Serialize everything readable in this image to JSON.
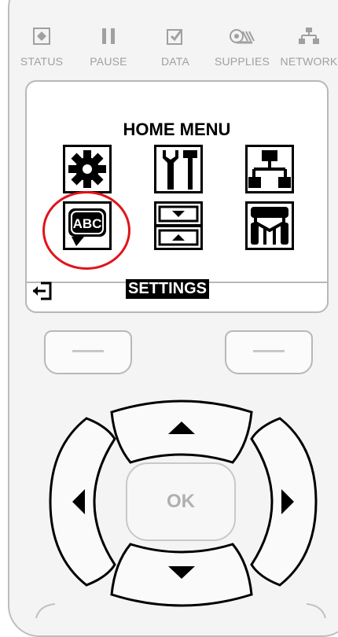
{
  "status_bar": {
    "items": [
      {
        "label": "STATUS",
        "icon": "status-diamond-icon"
      },
      {
        "label": "PAUSE",
        "icon": "pause-icon"
      },
      {
        "label": "DATA",
        "icon": "data-icon"
      },
      {
        "label": "SUPPLIES",
        "icon": "supplies-icon"
      },
      {
        "label": "NETWORK",
        "icon": "network-icon"
      }
    ],
    "color": "#a0a0a0"
  },
  "screen": {
    "title": "HOME MENU",
    "selected_label": "SETTINGS",
    "menu_icons": [
      "settings-gear-icon",
      "tools-icon",
      "network-tree-icon",
      "language-abc-icon",
      "sensor-icon",
      "ports-icon"
    ],
    "highlighted_icon": "language-abc-icon",
    "highlight_color": "#e1141b"
  },
  "keypad": {
    "ok_label": "OK",
    "buttons": [
      "left-softkey",
      "right-softkey",
      "up-arrow",
      "left-arrow",
      "ok",
      "right-arrow",
      "down-arrow"
    ]
  }
}
